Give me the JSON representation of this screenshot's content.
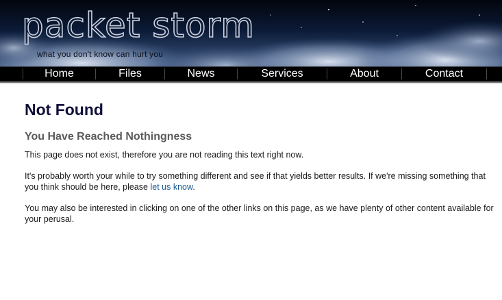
{
  "header": {
    "logo_text": "packet storm",
    "tagline": "what you don't know can hurt you"
  },
  "nav": {
    "items": [
      {
        "label": "Home"
      },
      {
        "label": "Files"
      },
      {
        "label": "News"
      },
      {
        "label": "Services"
      },
      {
        "label": "About"
      },
      {
        "label": "Contact"
      }
    ]
  },
  "main": {
    "title": "Not Found",
    "subtitle": "You Have Reached Nothingness",
    "paragraph1": "This page does not exist, therefore you are not reading this text right now.",
    "paragraph2_before": "It's probably worth your while to try something different and see if that yields better results. If we're missing something that you think should be here, please ",
    "paragraph2_link": "let us know",
    "paragraph2_after": ".",
    "paragraph3": "You may also be interested in clicking on one of the other links on this page, as we have plenty of other content available for your perusal."
  },
  "colors": {
    "title": "#10103a",
    "subtitle": "#5a5a5a",
    "link": "#1b5a93",
    "nav_bg": "#000000"
  }
}
